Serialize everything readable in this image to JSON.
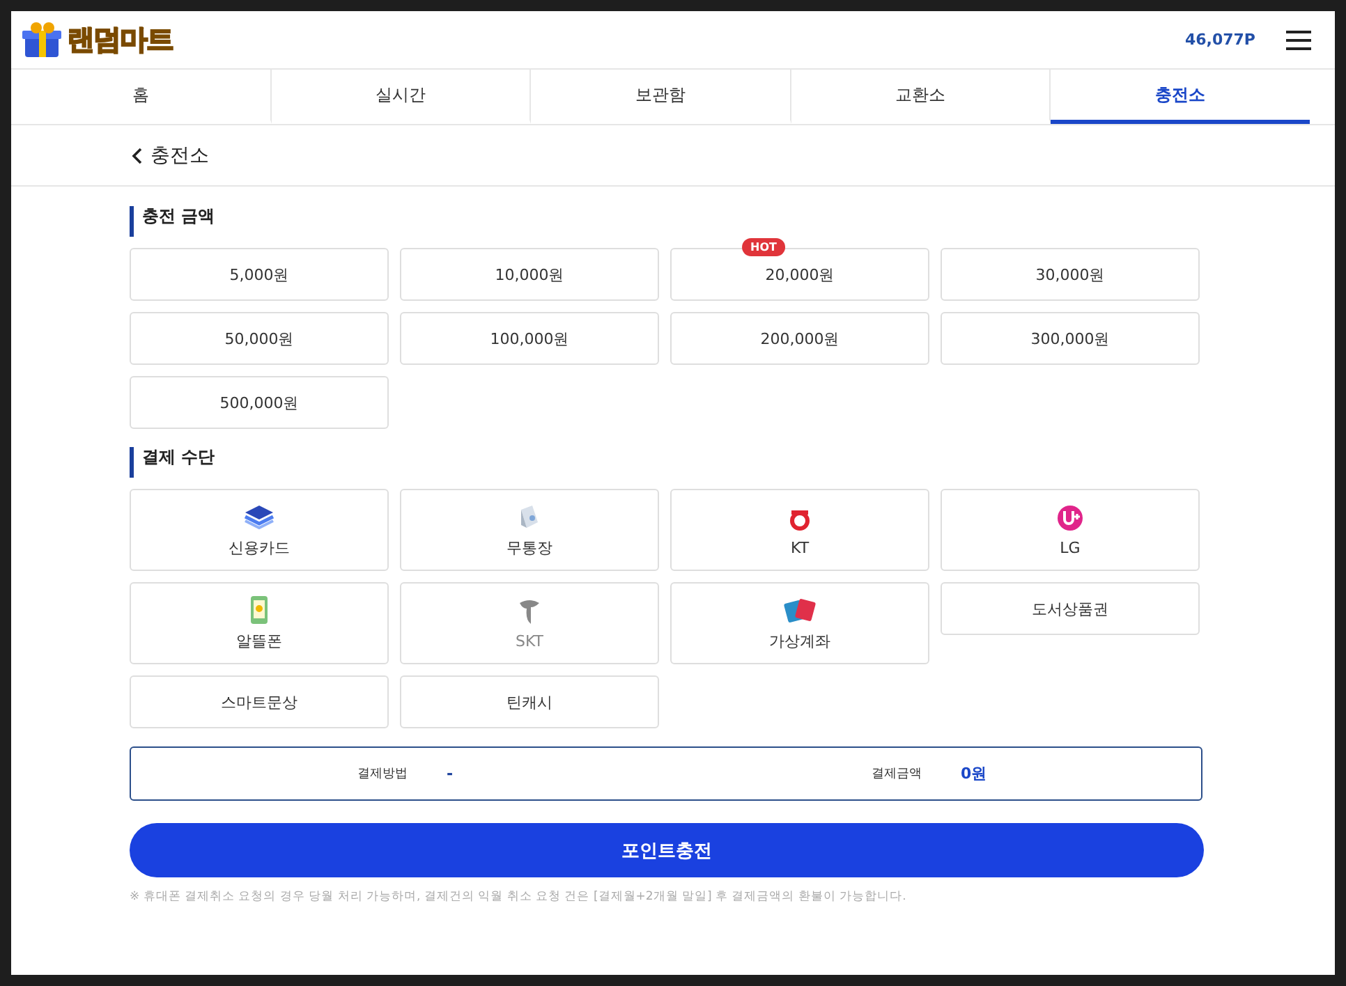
{
  "header": {
    "logo": "랜덤마트",
    "points": "46,077P"
  },
  "tabs": [
    {
      "label": "홈",
      "selected": false
    },
    {
      "label": "실시간",
      "selected": false
    },
    {
      "label": "보관함",
      "selected": false
    },
    {
      "label": "교환소",
      "selected": false
    },
    {
      "label": "충전소",
      "selected": true
    }
  ],
  "page_title": "충전소",
  "amount_section": {
    "title": "충전 금액",
    "options": [
      {
        "label": "5,000원",
        "selected": false
      },
      {
        "label": "10,000원",
        "selected": false
      },
      {
        "label": "20,000원",
        "selected": false,
        "badge": "HOT"
      },
      {
        "label": "30,000원",
        "selected": false
      },
      {
        "label": "50,000원",
        "selected": false
      },
      {
        "label": "100,000원",
        "selected": false
      },
      {
        "label": "200,000원",
        "selected": false
      },
      {
        "label": "300,000원",
        "selected": false
      },
      {
        "label": "500,000원",
        "selected": false
      }
    ]
  },
  "payment_section": {
    "title": "결제 수단",
    "methods": [
      {
        "label": "신용카드",
        "kind": "card",
        "selected": false,
        "disabled": false
      },
      {
        "label": "무통장",
        "kind": "bank",
        "selected": false,
        "disabled": false
      },
      {
        "label": "KT",
        "kind": "kt",
        "selected": false,
        "disabled": false
      },
      {
        "label": "LG",
        "kind": "lg",
        "selected": false,
        "disabled": false
      },
      {
        "label": "알뜰폰",
        "kind": "phone",
        "selected": false,
        "disabled": false
      },
      {
        "label": "SKT",
        "kind": "skt",
        "selected": false,
        "disabled": true
      },
      {
        "label": "가상계좌",
        "kind": "account",
        "selected": false,
        "disabled": false
      },
      {
        "label": "도서상품권",
        "kind": "text",
        "selected": false,
        "disabled": false
      },
      {
        "label": "스마트문상",
        "kind": "text",
        "selected": false,
        "disabled": false
      },
      {
        "label": "틴캐시",
        "kind": "text",
        "selected": false,
        "disabled": false
      }
    ]
  },
  "summary": {
    "method_label": "결제방법",
    "method_value": "-",
    "amount_label": "결제금액",
    "amount_value": "0원"
  },
  "submit_button": "포인트충전",
  "note": "※ 휴대폰 결제취소 요청의 경우 당월 처리 가능하며, 결제건의 익월 취소 요청 건은 [결제월+2개월 말일] 후 결제금액의 환불이 가능합니다."
}
